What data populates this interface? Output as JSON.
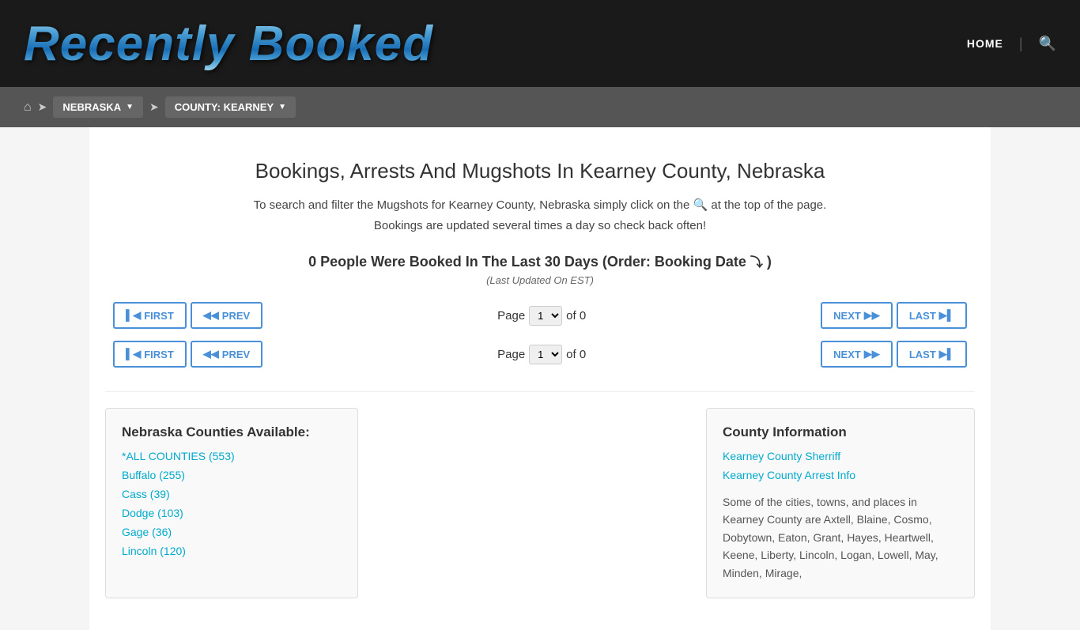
{
  "header": {
    "logo": "Recently Booked",
    "nav_home": "HOME",
    "search_label": "search"
  },
  "breadcrumb": {
    "home_label": "home",
    "nebraska_label": "NEBRASKA",
    "county_label": "COUNTY: KEARNEY"
  },
  "main": {
    "page_title": "Bookings, Arrests And Mugshots In Kearney County, Nebraska",
    "description_line1": "To search and filter the Mugshots for Kearney County, Nebraska simply click on the",
    "description_line2": "at the top of the page.",
    "description_line3": "Bookings are updated several times a day so check back often!",
    "booking_count_text": "0 People Were Booked In The Last 30 Days (Order: Booking Date",
    "last_updated": "(Last Updated On EST)",
    "pagination1": {
      "first_label": "FIRST",
      "prev_label": "PREV",
      "page_label": "Page",
      "of_label": "of 0",
      "next_label": "NEXT",
      "last_label": "LAST"
    },
    "pagination2": {
      "first_label": "FIRST",
      "prev_label": "PREV",
      "page_label": "Page",
      "of_label": "of 0",
      "next_label": "NEXT",
      "last_label": "LAST"
    }
  },
  "left_panel": {
    "title": "Nebraska Counties Available:",
    "links": [
      "*ALL COUNTIES (553)",
      "Buffalo (255)",
      "Cass (39)",
      "Dodge (103)",
      "Gage (36)",
      "Lincoln (120)"
    ]
  },
  "right_panel": {
    "title": "County Information",
    "links": [
      "Kearney County Sherriff",
      "Kearney County Arrest Info"
    ],
    "description": "Some of the cities, towns, and places in Kearney County are Axtell, Blaine, Cosmo, Dobytown, Eaton, Grant, Hayes, Heartwell, Keene, Liberty, Lincoln, Logan, Lowell, May, Minden, Mirage,"
  }
}
